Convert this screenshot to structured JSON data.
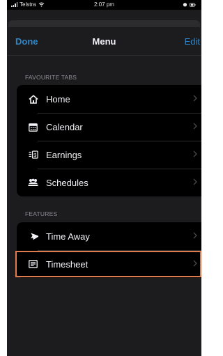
{
  "status_bar": {
    "carrier": "Telstra",
    "time": "2:07 pm"
  },
  "nav": {
    "done_label": "Done",
    "title": "Menu",
    "edit_label": "Edit"
  },
  "favourite_tabs": {
    "header": "FAVOURITE TABS",
    "items": [
      {
        "label": "Home",
        "icon": "home-icon"
      },
      {
        "label": "Calendar",
        "icon": "calendar-icon"
      },
      {
        "label": "Earnings",
        "icon": "earnings-icon"
      },
      {
        "label": "Schedules",
        "icon": "schedules-icon"
      }
    ]
  },
  "features": {
    "header": "FEATURES",
    "items": [
      {
        "label": "Time Away",
        "icon": "airplane-icon"
      },
      {
        "label": "Timesheet",
        "icon": "timesheet-icon"
      }
    ]
  },
  "colors": {
    "accent": "#2f87c9",
    "background": "#1c1c1e",
    "group": "#000000",
    "highlight": "#e07a4f"
  }
}
